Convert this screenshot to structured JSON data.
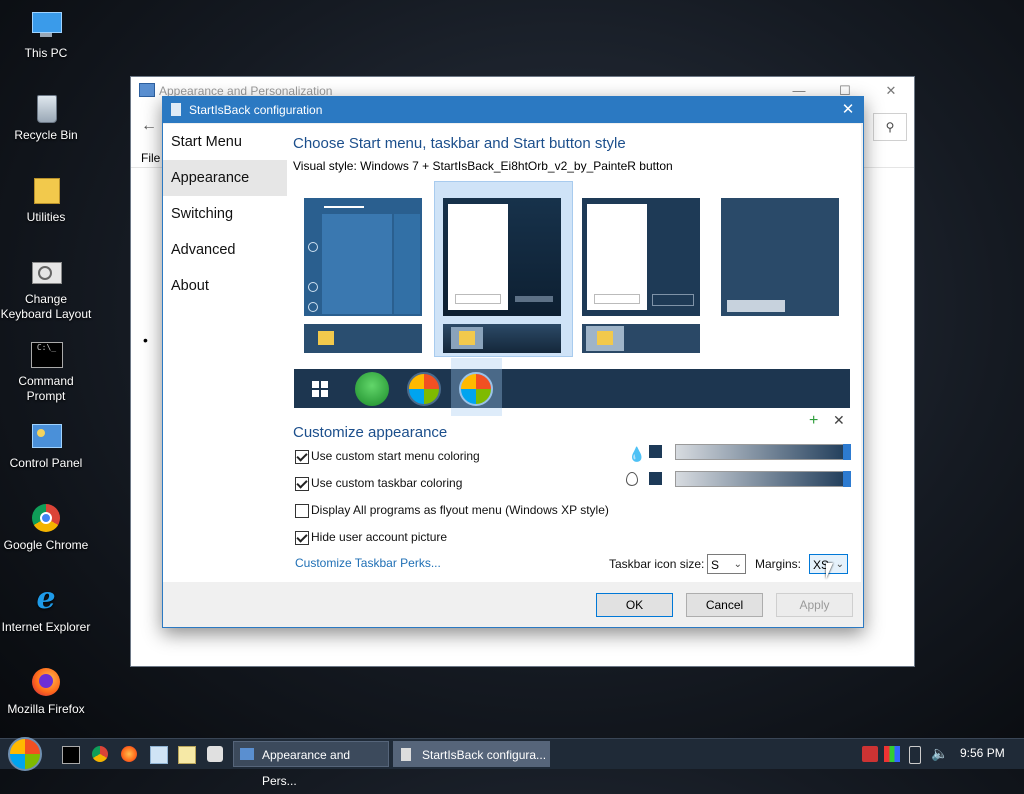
{
  "desktop": {
    "icons": [
      {
        "label": "This PC"
      },
      {
        "label": "Recycle Bin"
      },
      {
        "label": "Utilities"
      },
      {
        "label": "Change Keyboard Layout"
      },
      {
        "label": "Command Prompt"
      },
      {
        "label": "Control Panel"
      },
      {
        "label": "Google Chrome"
      },
      {
        "label": "Internet Explorer"
      },
      {
        "label": "Mozilla Firefox"
      }
    ]
  },
  "bg_window": {
    "title": "Appearance and Personalization",
    "menu_file": "File"
  },
  "dialog": {
    "title": "StartIsBack configuration",
    "nav": [
      "Start Menu",
      "Appearance",
      "Switching",
      "Advanced",
      "About"
    ],
    "selected_nav": "Appearance",
    "heading_style": "Choose Start menu, taskbar and Start button style",
    "visual_style_label": "Visual style:",
    "visual_style_value": "Windows 7 + StartIsBack_Ei8htOrb_v2_by_PainteR button",
    "heading_customize": "Customize appearance",
    "options": [
      {
        "label": "Use custom start menu coloring",
        "checked": true
      },
      {
        "label": "Use custom taskbar coloring",
        "checked": true
      },
      {
        "label": "Display All programs as flyout menu (Windows XP style)",
        "checked": false
      },
      {
        "label": "Hide user account picture",
        "checked": true
      }
    ],
    "perks_link": "Customize Taskbar Perks...",
    "icon_size_label": "Taskbar icon size:",
    "icon_size_value": "S",
    "margins_label": "Margins:",
    "margins_value": "XS",
    "buttons": {
      "ok": "OK",
      "cancel": "Cancel",
      "apply": "Apply"
    },
    "colors": {
      "accent": "#2b79c2",
      "swatch": "#1d3a58"
    }
  },
  "taskbar": {
    "tasks": [
      "Appearance and Pers...",
      "StartIsBack configura..."
    ],
    "clock": "9:56 PM"
  }
}
